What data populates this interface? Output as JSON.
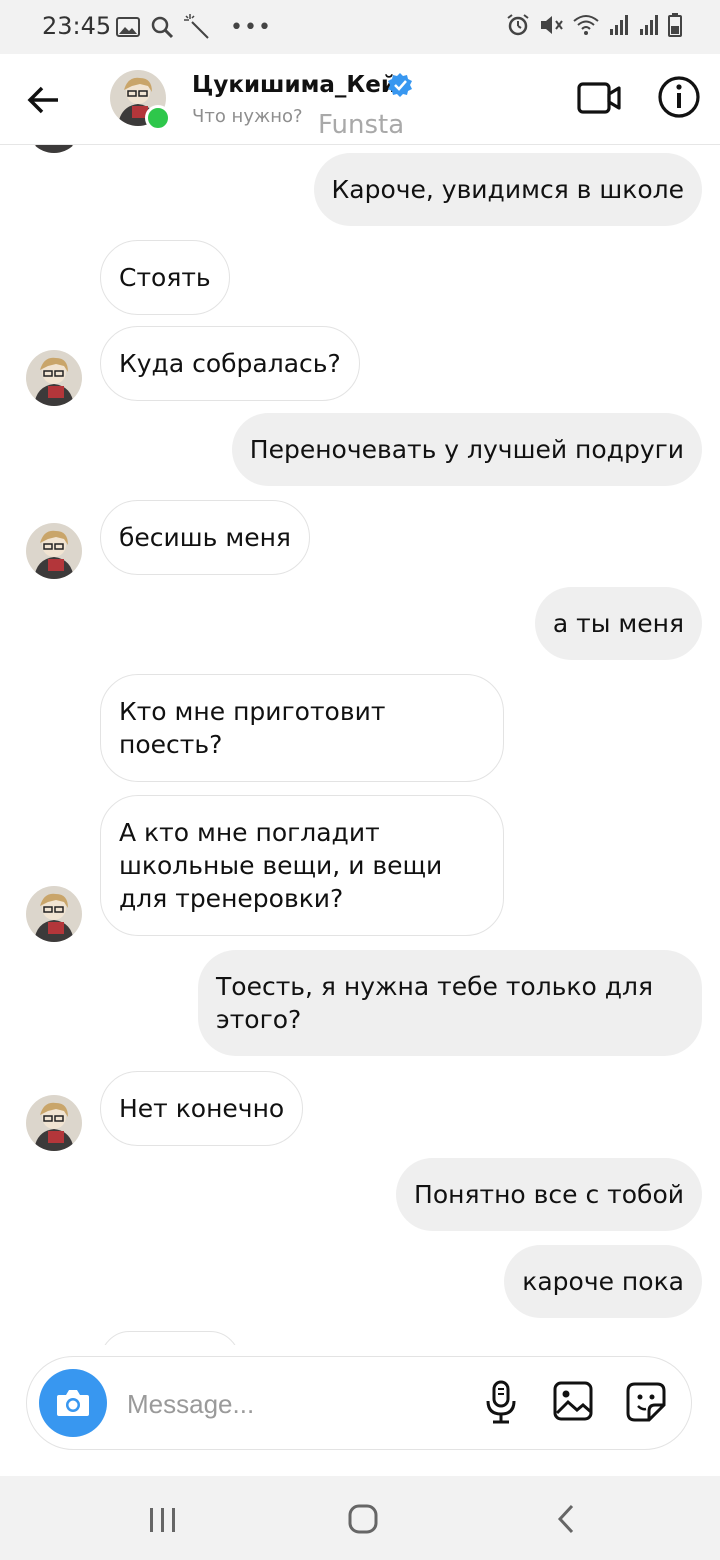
{
  "status_bar": {
    "time": "23:45",
    "left_icons": [
      "image-icon",
      "search-icon",
      "magic-wand-icon",
      "more-icon"
    ],
    "right_icons": [
      "alarm-icon",
      "mute-icon",
      "wifi-icon",
      "signal-icon",
      "signal-icon",
      "battery-icon"
    ]
  },
  "header": {
    "username": "Цукишима_Кей",
    "status": "Что нужно?",
    "label": "Funsta",
    "verified": true,
    "accent": "#3897f0",
    "online_color": "#2ec74b"
  },
  "messages": [
    {
      "side": "out",
      "text": "Кароче, увидимся в школе"
    },
    {
      "side": "in",
      "text": "Стоять"
    },
    {
      "side": "in",
      "text": "Куда собралась?"
    },
    {
      "side": "out",
      "text": "Переночевать у лучшей подруги"
    },
    {
      "side": "in",
      "text": "бесишь меня"
    },
    {
      "side": "out",
      "text": "а ты меня"
    },
    {
      "side": "in",
      "text": "Кто мне приготовит поесть?"
    },
    {
      "side": "in",
      "text": "А кто мне погладит школьные вещи, и вещи для тренеровки?"
    },
    {
      "side": "out",
      "text": "Тоесть, я нужна тебе только для этого?"
    },
    {
      "side": "in",
      "text": "Нет конечно"
    },
    {
      "side": "out",
      "text": "Понятно все с тобой"
    },
    {
      "side": "out",
      "text": "кароче пока"
    }
  ],
  "composer": {
    "placeholder": "Message..."
  },
  "nav_bar": {
    "buttons": [
      "recent-apps",
      "home",
      "back"
    ]
  }
}
